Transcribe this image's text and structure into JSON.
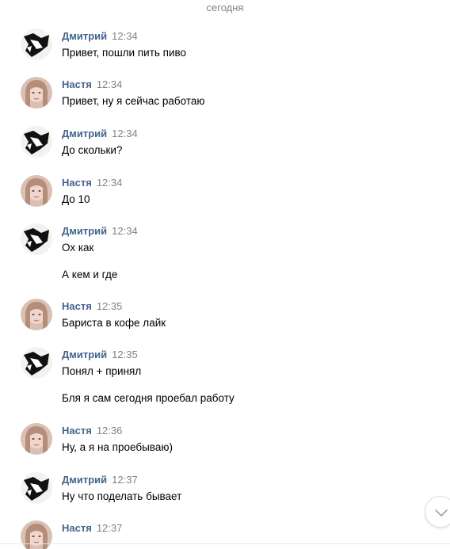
{
  "day_separator": "сегодня",
  "messages": [
    {
      "author": "Дмитрий",
      "avatar": "dmitry-avatar",
      "time": "12:34",
      "lines": [
        "Привет, пошли пить пиво"
      ]
    },
    {
      "author": "Настя",
      "avatar": "nastya-avatar",
      "time": "12:34",
      "lines": [
        "Привет, ну я сейчас работаю"
      ]
    },
    {
      "author": "Дмитрий",
      "avatar": "dmitry-avatar",
      "time": "12:34",
      "lines": [
        "До скольки?"
      ]
    },
    {
      "author": "Настя",
      "avatar": "nastya-avatar",
      "time": "12:34",
      "lines": [
        "До 10"
      ]
    },
    {
      "author": "Дмитрий",
      "avatar": "dmitry-avatar",
      "time": "12:34",
      "lines": [
        "Ох как",
        "А кем и где"
      ]
    },
    {
      "author": "Настя",
      "avatar": "nastya-avatar",
      "time": "12:35",
      "lines": [
        "Бариста в кофе лайк"
      ]
    },
    {
      "author": "Дмитрий",
      "avatar": "dmitry-avatar",
      "time": "12:35",
      "lines": [
        "Понял + принял",
        "Бля я сам сегодня проебал работу"
      ]
    },
    {
      "author": "Настя",
      "avatar": "nastya-avatar",
      "time": "12:36",
      "lines": [
        "Ну, а я на проебываю)"
      ]
    },
    {
      "author": "Дмитрий",
      "avatar": "dmitry-avatar",
      "time": "12:37",
      "lines": [
        "Ну что поделать бывает"
      ]
    },
    {
      "author": "Настя",
      "avatar": "nastya-avatar",
      "time": "12:37",
      "lines": []
    }
  ],
  "scroll_button_icon": "chevron-down-icon",
  "colors": {
    "author": "#42648b",
    "time": "#828282",
    "text": "#000000",
    "separator": "#828282"
  }
}
